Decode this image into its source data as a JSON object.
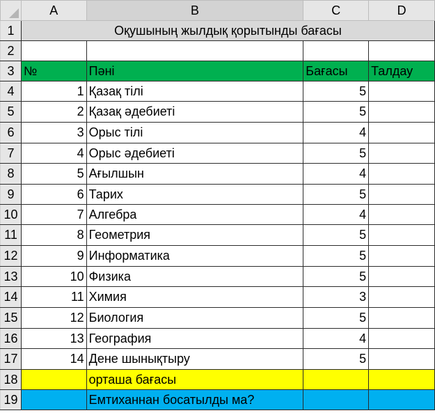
{
  "columns": [
    "A",
    "B",
    "C",
    "D"
  ],
  "rows": [
    {
      "num": "1",
      "a": "",
      "b": "Оқушының жылдық қорытынды бағасы",
      "c": "",
      "d": ""
    },
    {
      "num": "2",
      "a": "",
      "b": "",
      "c": "",
      "d": ""
    },
    {
      "num": "3",
      "a": "№",
      "b": "Пәні",
      "c": "Бағасы",
      "d": "Талдау"
    },
    {
      "num": "4",
      "a": "1",
      "b": "Қазақ тілі",
      "c": "5",
      "d": ""
    },
    {
      "num": "5",
      "a": "2",
      "b": "Қазақ әдебиеті",
      "c": "5",
      "d": ""
    },
    {
      "num": "6",
      "a": "3",
      "b": "Орыс тілі",
      "c": "4",
      "d": ""
    },
    {
      "num": "7",
      "a": "4",
      "b": "Орыс әдебиеті",
      "c": "5",
      "d": ""
    },
    {
      "num": "8",
      "a": "5",
      "b": "Ағылшын",
      "c": "4",
      "d": ""
    },
    {
      "num": "9",
      "a": "6",
      "b": "Тарих",
      "c": "5",
      "d": ""
    },
    {
      "num": "10",
      "a": "7",
      "b": "Алгебра",
      "c": "4",
      "d": ""
    },
    {
      "num": "11",
      "a": "8",
      "b": "Геометрия",
      "c": "5",
      "d": ""
    },
    {
      "num": "12",
      "a": "9",
      "b": "Информатика",
      "c": "5",
      "d": ""
    },
    {
      "num": "13",
      "a": "10",
      "b": "Физика",
      "c": "5",
      "d": ""
    },
    {
      "num": "14",
      "a": "11",
      "b": "Химия",
      "c": "3",
      "d": ""
    },
    {
      "num": "15",
      "a": "12",
      "b": "Биология",
      "c": "5",
      "d": ""
    },
    {
      "num": "16",
      "a": "13",
      "b": "География",
      "c": "4",
      "d": ""
    },
    {
      "num": "17",
      "a": "14",
      "b": "Дене шынықтыру",
      "c": "5",
      "d": ""
    },
    {
      "num": "18",
      "a": "",
      "b": "орташа бағасы",
      "c": "",
      "d": ""
    },
    {
      "num": "19",
      "a": "",
      "b": "Емтиханнан босатылды ма?",
      "c": "",
      "d": ""
    }
  ],
  "colors": {
    "title_fill": "#d9d9d9",
    "header_fill": "#00b050",
    "average_fill": "#ffff00",
    "exam_fill": "#00b0f0"
  }
}
